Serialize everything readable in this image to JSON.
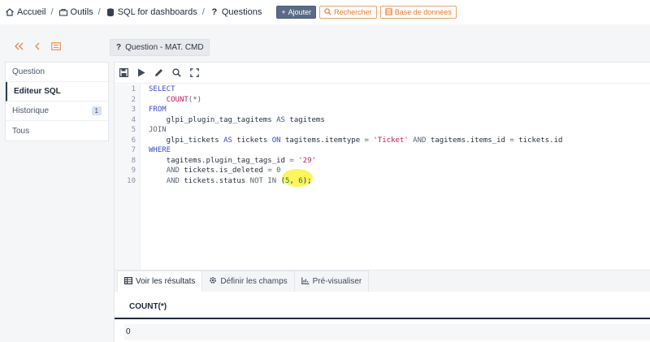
{
  "breadcrumb": [
    {
      "icon": "home-icon",
      "label": "Accueil"
    },
    {
      "icon": "toolbox-icon",
      "label": "Outils"
    },
    {
      "icon": "database-icon",
      "label": "SQL for dashboards"
    },
    {
      "icon": "question-icon",
      "label": "Questions"
    }
  ],
  "actions": {
    "add": "Ajouter",
    "search": "Rechercher",
    "database": "Base de données"
  },
  "colors": {
    "accent": "#ef8a3e",
    "primary": "#5a6b86",
    "highlight": "#fff34a"
  },
  "question_title": "Question - MAT. CMD",
  "menu": [
    {
      "label": "Question",
      "badge": ""
    },
    {
      "label": "Editeur SQL",
      "badge": ""
    },
    {
      "label": "Historique",
      "badge": "1"
    },
    {
      "label": "Tous",
      "badge": ""
    }
  ],
  "toolbar_icons": [
    "save-icon",
    "run-icon",
    "edit-icon",
    "search-icon",
    "fullscreen-icon"
  ],
  "code_lines": [
    {
      "n": "1",
      "parts": [
        [
          "kw",
          "SELECT"
        ]
      ]
    },
    {
      "n": "2",
      "parts": [
        [
          "plain",
          "    "
        ],
        [
          "fn",
          "COUNT"
        ],
        [
          "op",
          "(*)"
        ]
      ]
    },
    {
      "n": "3",
      "parts": [
        [
          "kw",
          "FROM"
        ]
      ]
    },
    {
      "n": "4",
      "parts": [
        [
          "plain",
          "    glpi_plugin_tag_tagitems "
        ],
        [
          "kw",
          "AS"
        ],
        [
          "plain",
          " tagitems"
        ]
      ]
    },
    {
      "n": "5",
      "parts": [
        [
          "op",
          "JOIN"
        ]
      ]
    },
    {
      "n": "6",
      "parts": [
        [
          "plain",
          "    glpi_tickets "
        ],
        [
          "kw",
          "AS"
        ],
        [
          "plain",
          " tickets "
        ],
        [
          "kw",
          "ON"
        ],
        [
          "plain",
          " tagitems.itemtype "
        ],
        [
          "op",
          "="
        ],
        [
          "plain",
          " "
        ],
        [
          "str",
          "'Ticket'"
        ],
        [
          "plain",
          " "
        ],
        [
          "op",
          "AND"
        ],
        [
          "plain",
          " tagitems.items_id "
        ],
        [
          "op",
          "="
        ],
        [
          "plain",
          " tickets.id"
        ]
      ]
    },
    {
      "n": "7",
      "parts": [
        [
          "kw",
          "WHERE"
        ]
      ]
    },
    {
      "n": "8",
      "parts": [
        [
          "plain",
          "    tagitems.plugin_tag_tags_id "
        ],
        [
          "op",
          "="
        ],
        [
          "plain",
          " "
        ],
        [
          "str",
          "'29'"
        ]
      ]
    },
    {
      "n": "9",
      "parts": [
        [
          "plain",
          "    "
        ],
        [
          "op",
          "AND"
        ],
        [
          "plain",
          " tickets.is_deleted "
        ],
        [
          "op",
          "="
        ],
        [
          "plain",
          " "
        ],
        [
          "num",
          "0"
        ]
      ]
    },
    {
      "n": "10",
      "parts": [
        [
          "plain",
          "    "
        ],
        [
          "op",
          "AND"
        ],
        [
          "plain",
          " tickets.status "
        ],
        [
          "op",
          "NOT IN"
        ],
        [
          "plain",
          " ("
        ],
        [
          "num",
          "5"
        ],
        [
          "plain",
          ", "
        ],
        [
          "num",
          "6"
        ],
        [
          "plain",
          ");"
        ]
      ]
    }
  ],
  "tabs": [
    {
      "icon": "table-icon",
      "label": "Voir les résultats"
    },
    {
      "icon": "gear-icon",
      "label": "Définir les champs"
    },
    {
      "icon": "chart-icon",
      "label": "Pré-visualiser"
    }
  ],
  "results": {
    "column": "COUNT(*)",
    "value": "0"
  }
}
